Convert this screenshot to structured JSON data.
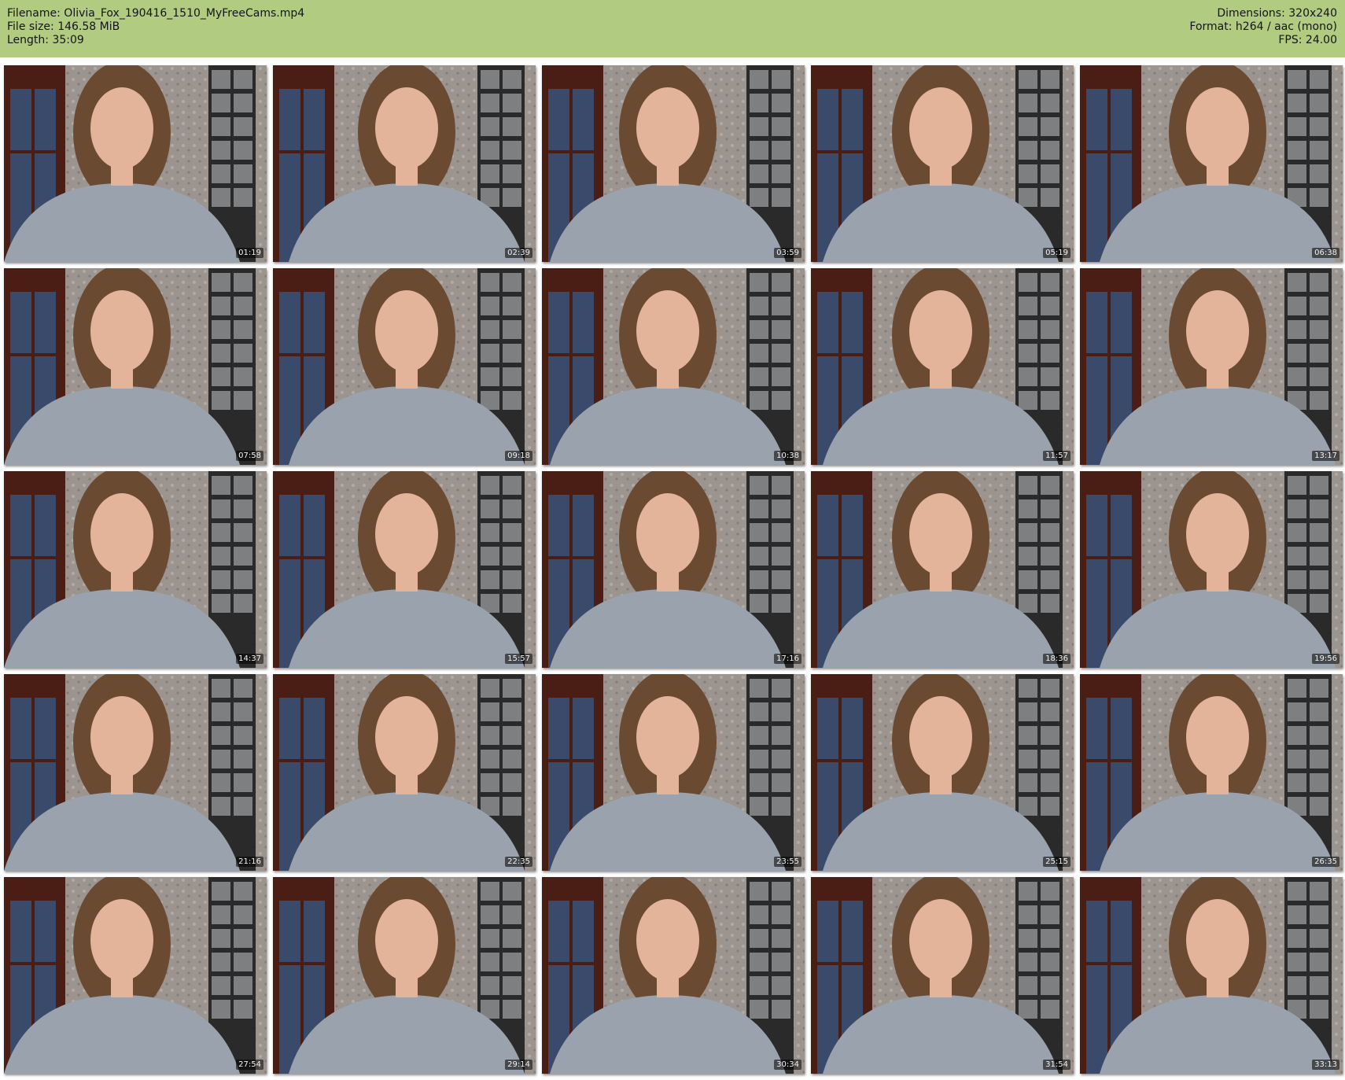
{
  "header": {
    "filename_line": "Filename: Olivia_Fox_190416_1510_MyFreeCams.mp4",
    "filesize_line": "File size: 146.58 MiB",
    "length_line": "Length: 35:09",
    "dimensions_line": "Dimensions: 320x240",
    "format_line": "Format: h264 / aac (mono)",
    "fps_line": "FPS: 24.00",
    "background_color": "#b1cc81"
  },
  "thumbnails": [
    {
      "time": "01:19"
    },
    {
      "time": "02:39"
    },
    {
      "time": "03:59"
    },
    {
      "time": "05:19"
    },
    {
      "time": "06:38"
    },
    {
      "time": "07:58"
    },
    {
      "time": "09:18"
    },
    {
      "time": "10:38"
    },
    {
      "time": "11:57"
    },
    {
      "time": "13:17"
    },
    {
      "time": "14:37"
    },
    {
      "time": "15:57"
    },
    {
      "time": "17:16"
    },
    {
      "time": "18:36"
    },
    {
      "time": "19:56"
    },
    {
      "time": "21:16"
    },
    {
      "time": "22:35"
    },
    {
      "time": "23:55"
    },
    {
      "time": "25:15"
    },
    {
      "time": "26:35"
    },
    {
      "time": "27:54"
    },
    {
      "time": "29:14"
    },
    {
      "time": "30:34"
    },
    {
      "time": "31:54"
    },
    {
      "time": "33:13"
    }
  ]
}
